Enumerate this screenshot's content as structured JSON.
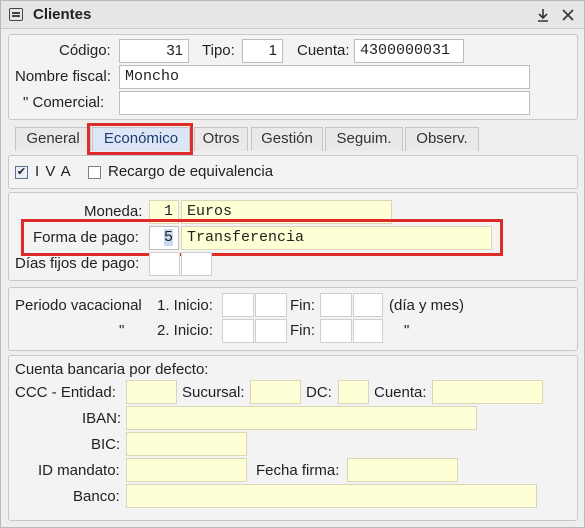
{
  "window": {
    "title": "Clientes"
  },
  "header": {
    "codigo_label": "Código:",
    "codigo_value": "31",
    "tipo_label": "Tipo:",
    "tipo_value": "1",
    "cuenta_label": "Cuenta:",
    "cuenta_value": "4300000031",
    "nombre_fiscal_label": "Nombre fiscal:",
    "nombre_fiscal_value": "Moncho",
    "comercial_label": "\"  Comercial:",
    "comercial_value": ""
  },
  "tabs": [
    {
      "label": "General"
    },
    {
      "label": "Económico",
      "active": true
    },
    {
      "label": "Otros"
    },
    {
      "label": "Gestión"
    },
    {
      "label": "Seguim."
    },
    {
      "label": "Observ."
    }
  ],
  "taxes": {
    "iva_label": "I V A",
    "iva_checked": true,
    "recargo_label": "Recargo de equivalencia",
    "recargo_checked": false
  },
  "payment": {
    "moneda_label": "Moneda:",
    "moneda_code": "1",
    "moneda_name": "Euros",
    "forma_pago_label": "Forma de pago:",
    "forma_pago_code": "5",
    "forma_pago_name": "Transferencia",
    "dias_fijos_label": "Días fijos de pago:"
  },
  "vacation": {
    "periodo_label": "Periodo vacacional",
    "row1_label": "1.  Inicio:",
    "row2_quote": "\"",
    "row2_label": "2.  Inicio:",
    "fin_label": "Fin:",
    "hint": "(día y mes)",
    "hint2_quote": "\""
  },
  "bank": {
    "section_label": "Cuenta bancaria por defecto:",
    "ccc_label": "CCC - Entidad:",
    "sucursal_label": "Sucursal:",
    "dc_label": "DC:",
    "cuenta_label": "Cuenta:",
    "iban_label": "IBAN:",
    "bic_label": "BIC:",
    "mandato_label": "ID mandato:",
    "fecha_firma_label": "Fecha firma:",
    "banco_label": "Banco:"
  },
  "colors": {
    "highlight": "#e02b2b",
    "readonly_field": "#ffffd6",
    "active_tab": "#dde6f4"
  }
}
